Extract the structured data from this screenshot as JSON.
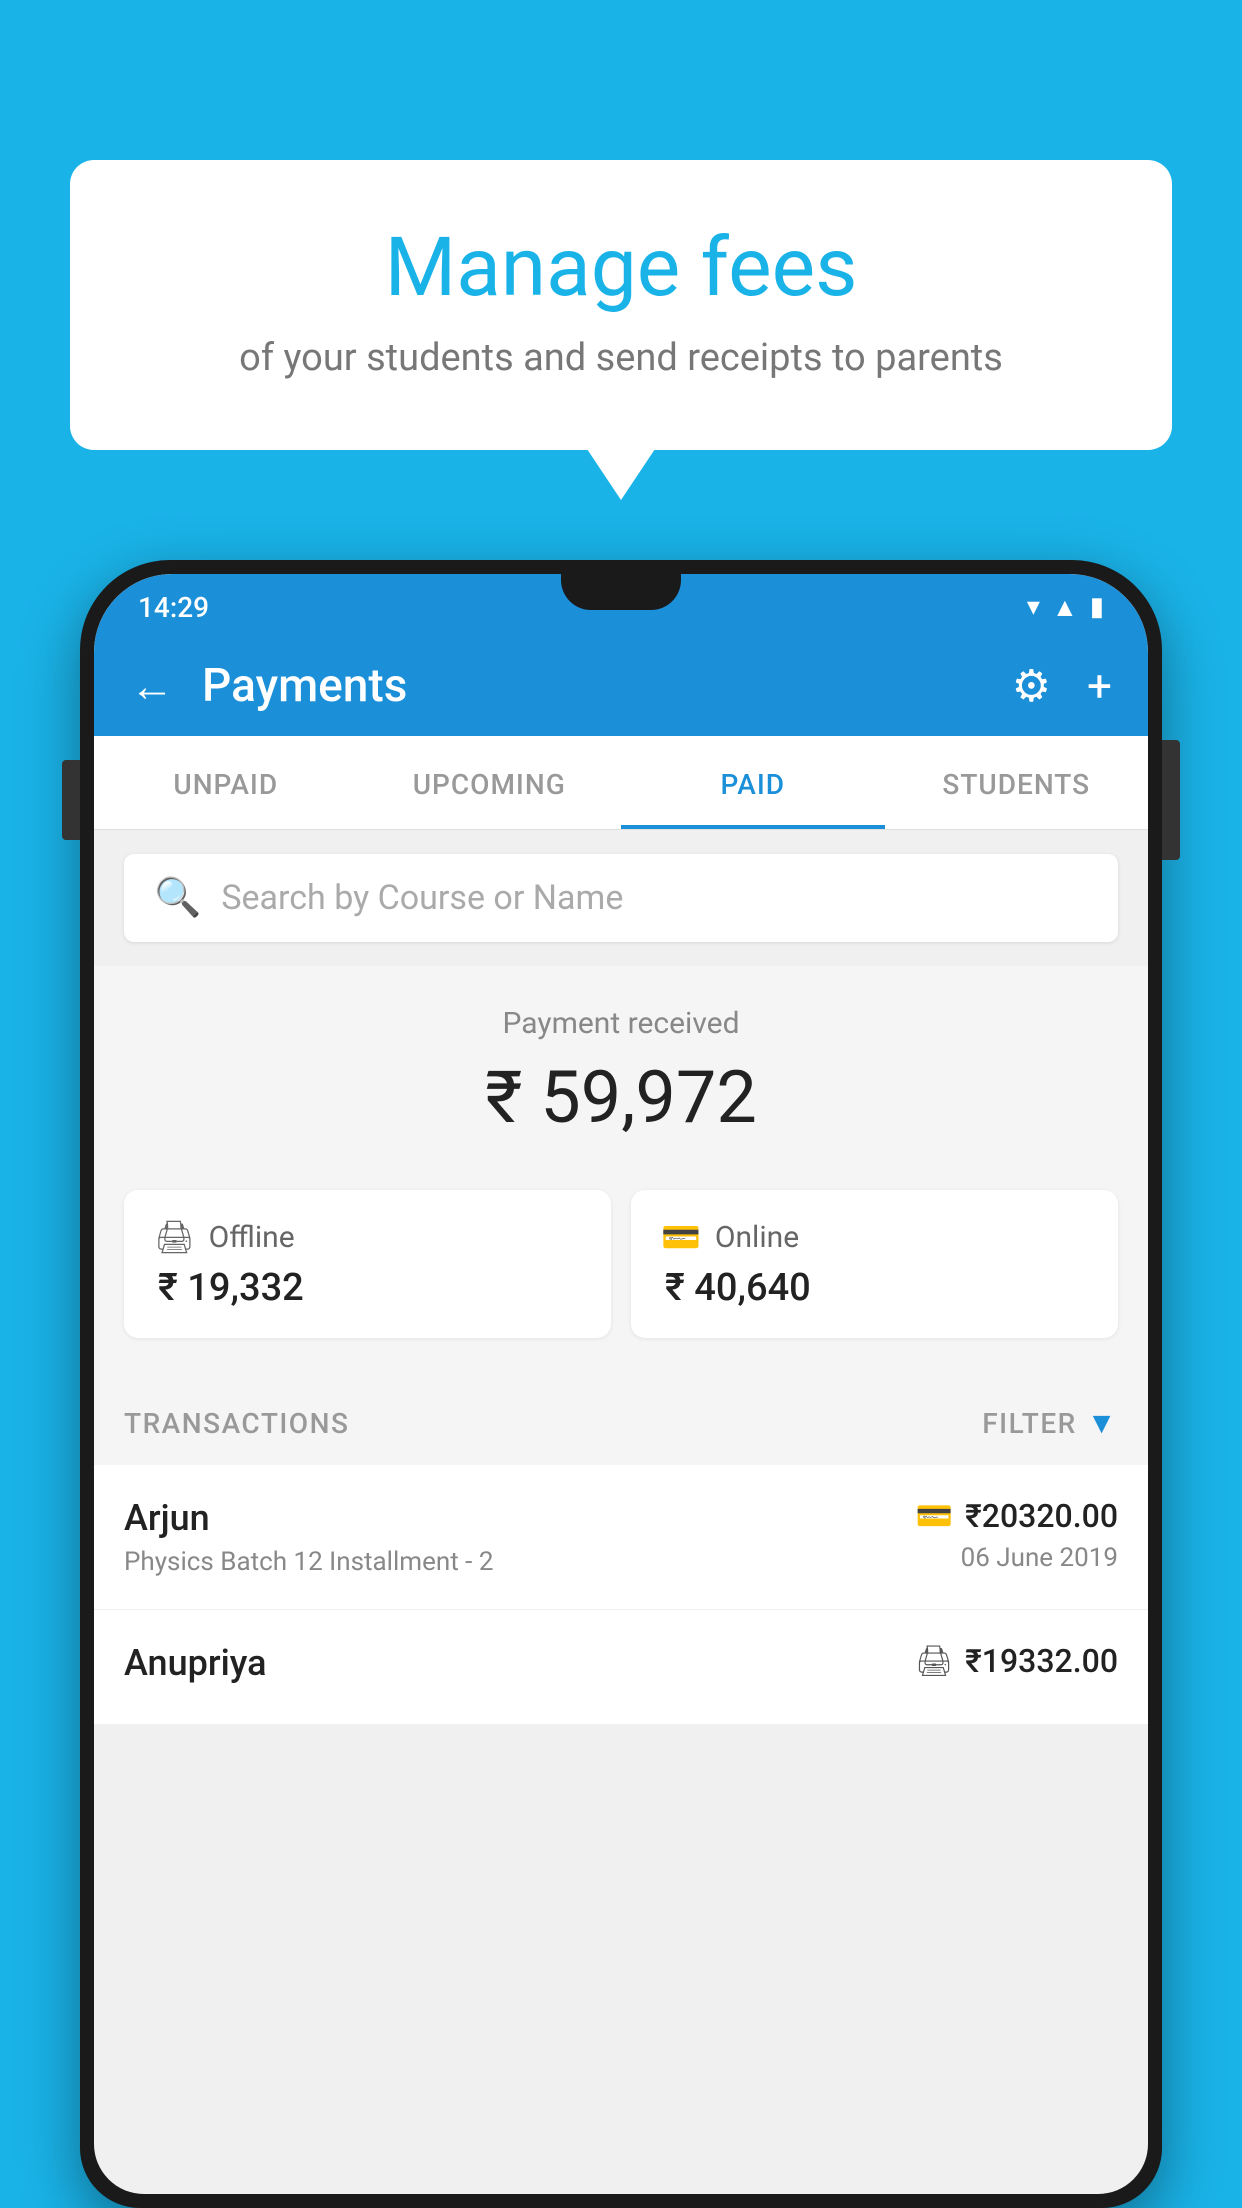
{
  "background_color": "#1ab3e8",
  "bubble": {
    "title": "Manage fees",
    "subtitle": "of your students and send receipts to parents"
  },
  "status_bar": {
    "time": "14:29"
  },
  "app_bar": {
    "title": "Payments",
    "back_label": "←",
    "gear_label": "⚙",
    "plus_label": "+"
  },
  "tabs": [
    {
      "label": "UNPAID",
      "active": false
    },
    {
      "label": "UPCOMING",
      "active": false
    },
    {
      "label": "PAID",
      "active": true
    },
    {
      "label": "STUDENTS",
      "active": false
    }
  ],
  "search": {
    "placeholder": "Search by Course or Name"
  },
  "payment_received": {
    "label": "Payment received",
    "amount": "₹ 59,972"
  },
  "payment_cards": [
    {
      "icon": "💳",
      "label": "Offline",
      "amount": "₹ 19,332"
    },
    {
      "icon": "💳",
      "label": "Online",
      "amount": "₹ 40,640"
    }
  ],
  "transactions": {
    "header": "TRANSACTIONS",
    "filter_label": "FILTER"
  },
  "transaction_rows": [
    {
      "name": "Arjun",
      "detail": "Physics Batch 12 Installment - 2",
      "amount": "₹20320.00",
      "date": "06 June 2019",
      "method": "online"
    },
    {
      "name": "Anupriya",
      "detail": "",
      "amount": "₹19332.00",
      "date": "",
      "method": "offline"
    }
  ]
}
